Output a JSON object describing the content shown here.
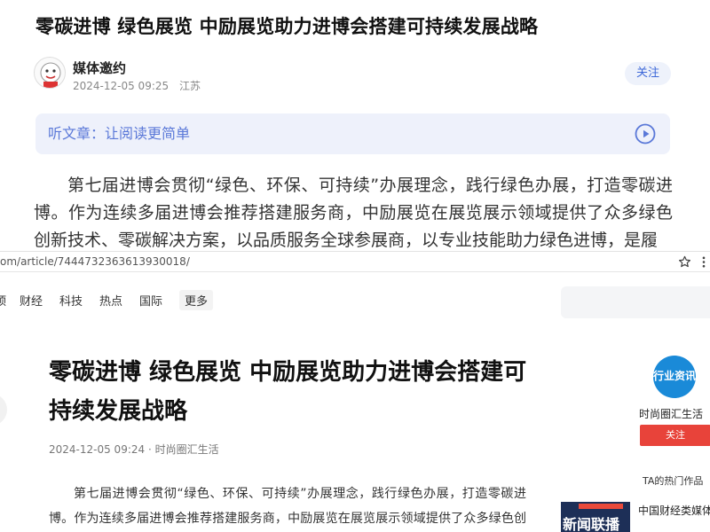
{
  "top_article": {
    "title": "零碳进博 绿色展览 中励展览助力进博会搭建可持续发展战略",
    "author": "媒体邀约",
    "date": "2024-12-05 09:25",
    "location": "江苏",
    "follow_label": "关注",
    "listen_label": "听文章：让阅读更简单",
    "body": "第七届进博会贯彻“绿色、环保、可持续”办展理念，践行绿色办展，打造零碳进博。作为连续多届进博会推荐搭建服务商，中励展览在展览展示领域提供了众多绿色创新技术、零碳解决方案，以品质服务全球参展商，以专业技能助力绿色进博，是履"
  },
  "browser": {
    "url": "om/article/7444732363613930018/"
  },
  "nav": {
    "items": [
      "顶",
      "财经",
      "科技",
      "热点",
      "国际",
      "更多"
    ]
  },
  "article": {
    "title": "零碳进博 绿色展览 中励展览助力进博会搭建可持续发展战略",
    "meta": "2024-12-05 09:24 · 时尚圈汇生活",
    "body": "第七届进博会贯彻“绿色、环保、可持续”办展理念，践行绿色办展，打造零碳进博。作为连续多届进博会推荐搭建服务商，中励展览在展览展示领域提供了众多绿色创新技术、零碳解决方案，以品质服务全球参展商，以专业技能助力绿色进博，是"
  },
  "sidebar": {
    "logo_text": "行业资讯",
    "name": "时尚圈汇生活",
    "follow_label": "关注",
    "hot_label": "TA的热门作品",
    "thumb_text": "新闻联播",
    "item_title": "中国财经类媒体"
  },
  "colors": {
    "accent_blue": "#3d68d8",
    "follow_red": "#e8433a"
  }
}
